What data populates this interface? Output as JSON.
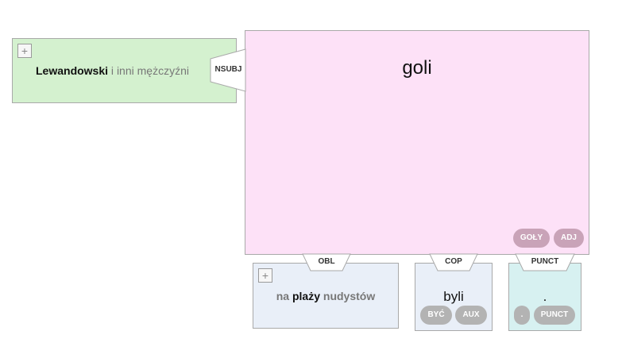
{
  "subject": {
    "words": [
      {
        "text": "Lewandowski",
        "style": "head"
      },
      {
        "text": "i",
        "style": "dep-light"
      },
      {
        "text": "inni",
        "style": "dep-light"
      },
      {
        "text": "mężczyźni",
        "style": "dep-light"
      }
    ],
    "relation": "NSUBJ",
    "color": "#d4f1cf",
    "expand_symbol": "+"
  },
  "root": {
    "word": "goli",
    "lemma": "GOŁY",
    "pos": "ADJ",
    "color": "#fde1f7"
  },
  "oblique": {
    "words": [
      {
        "text": "na",
        "style": "dep"
      },
      {
        "text": "plaży",
        "style": "head"
      },
      {
        "text": "nudystów",
        "style": "dep"
      }
    ],
    "relation": "OBL",
    "color": "#e9eff8",
    "expand_symbol": "+"
  },
  "copula": {
    "word": "byli",
    "lemma": "BYĆ",
    "pos": "AUX",
    "relation": "COP",
    "color": "#e9eff8"
  },
  "punct": {
    "word": ".",
    "lemma": ".",
    "pos": "PUNCT",
    "relation": "PUNCT",
    "color": "#d7f1f1"
  }
}
